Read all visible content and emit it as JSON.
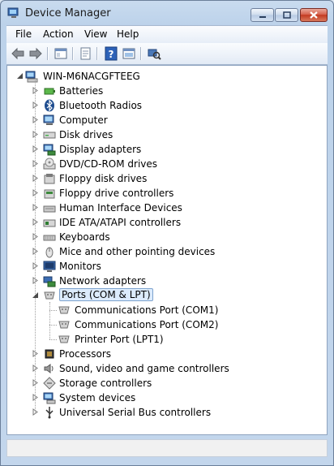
{
  "window": {
    "title": "Device Manager"
  },
  "menu": [
    "File",
    "Action",
    "View",
    "Help"
  ],
  "toolbar": [
    "back-icon",
    "forward-icon",
    "properties-panel-icon",
    "document-icon",
    "help-icon",
    "show-hidden-icon",
    "scan-hardware-icon"
  ],
  "tree": {
    "root": "WIN-M6NACGFTEEG",
    "categories": [
      {
        "label": "Batteries",
        "icon": "battery-icon",
        "expanded": false
      },
      {
        "label": "Bluetooth Radios",
        "icon": "bluetooth-icon",
        "expanded": false
      },
      {
        "label": "Computer",
        "icon": "computer-icon",
        "expanded": false
      },
      {
        "label": "Disk drives",
        "icon": "disk-drive-icon",
        "expanded": false
      },
      {
        "label": "Display adapters",
        "icon": "display-adapter-icon",
        "expanded": false
      },
      {
        "label": "DVD/CD-ROM drives",
        "icon": "dvd-drive-icon",
        "expanded": false
      },
      {
        "label": "Floppy disk drives",
        "icon": "floppy-icon",
        "expanded": false
      },
      {
        "label": "Floppy drive controllers",
        "icon": "floppy-controller-icon",
        "expanded": false
      },
      {
        "label": "Human Interface Devices",
        "icon": "hid-icon",
        "expanded": false
      },
      {
        "label": "IDE ATA/ATAPI controllers",
        "icon": "ide-controller-icon",
        "expanded": false
      },
      {
        "label": "Keyboards",
        "icon": "keyboard-icon",
        "expanded": false
      },
      {
        "label": "Mice and other pointing devices",
        "icon": "mouse-icon",
        "expanded": false
      },
      {
        "label": "Monitors",
        "icon": "monitor-icon",
        "expanded": false
      },
      {
        "label": "Network adapters",
        "icon": "network-adapter-icon",
        "expanded": false
      },
      {
        "label": "Ports (COM & LPT)",
        "icon": "port-icon",
        "expanded": true,
        "selected": true,
        "children": [
          "Communications Port (COM1)",
          "Communications Port (COM2)",
          "Printer Port (LPT1)"
        ]
      },
      {
        "label": "Processors",
        "icon": "processor-icon",
        "expanded": false
      },
      {
        "label": "Sound, video and game controllers",
        "icon": "sound-icon",
        "expanded": false
      },
      {
        "label": "Storage controllers",
        "icon": "storage-controller-icon",
        "expanded": false
      },
      {
        "label": "System devices",
        "icon": "system-device-icon",
        "expanded": false
      },
      {
        "label": "Universal Serial Bus controllers",
        "icon": "usb-icon",
        "expanded": false
      }
    ]
  },
  "colors": {
    "selection_bg": "#dcebfc",
    "selection_border": "#7da2ce",
    "title_bg": "#c9dbef"
  }
}
